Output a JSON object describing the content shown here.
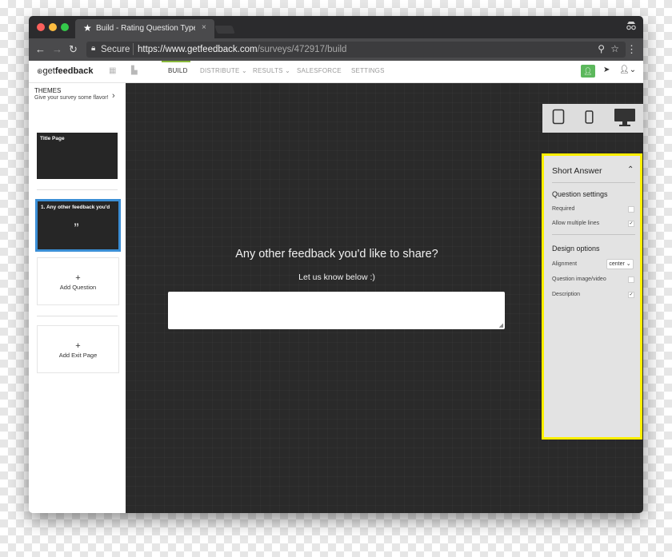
{
  "browser": {
    "tab_title": "Build - Rating Question Type E",
    "tab_close": "×",
    "secure_label": "Secure",
    "url_host": "https://www.getfeedback.com",
    "url_path": "/surveys/472917/build"
  },
  "app": {
    "logo_prefix": "get",
    "logo_bold": "feedback",
    "nav": [
      "BUILD",
      "DISTRIBUTE ⌄",
      "RESULTS ⌄",
      "SALESFORCE",
      "SETTINGS"
    ],
    "active_nav": "BUILD"
  },
  "sidebar": {
    "themes_title": "THEMES",
    "themes_subtitle": "Give your survey some flavor!",
    "title_page": "Title Page",
    "question_page": "1. Any other feedback you'd",
    "quote_glyph": "”",
    "add_question": "Add Question",
    "add_exit_page": "Add Exit Page",
    "plus": "+"
  },
  "canvas": {
    "question": "Any other feedback you'd like to share?",
    "description": "Let us know below :)",
    "answer_value": ""
  },
  "panel": {
    "title": "Short Answer",
    "question_settings": "Question settings",
    "required": "Required",
    "allow_multiple": "Allow multiple lines",
    "design_options": "Design options",
    "alignment": "Alignment",
    "alignment_value": "center ⌄",
    "image_video": "Question image/video",
    "description": "Description",
    "required_checked": false,
    "allow_multiple_checked": true,
    "image_video_checked": false,
    "description_checked": true,
    "check_glyph": "✓"
  },
  "colors": {
    "highlight": "#ffef00",
    "canvas_bg": "#2a2a2a",
    "selected_border": "#3b8fd6",
    "accent_green": "#5cb85c"
  }
}
